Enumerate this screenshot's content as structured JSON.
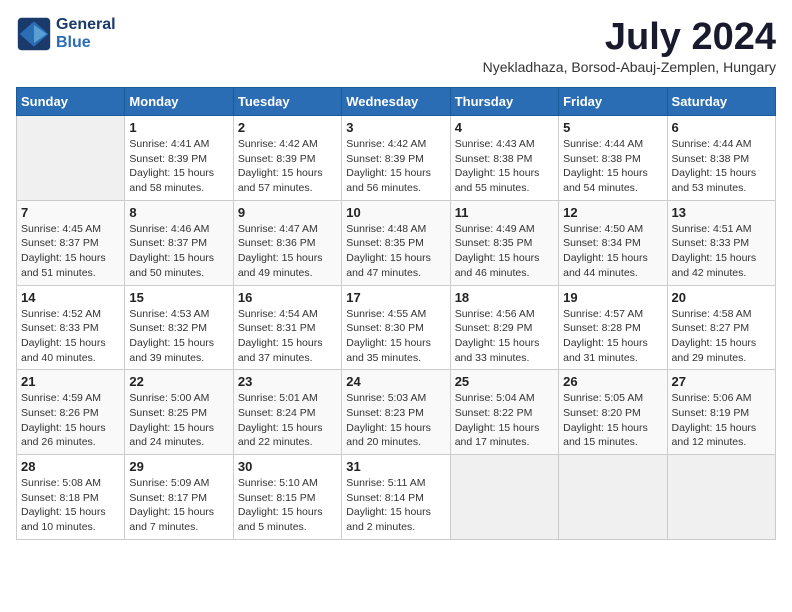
{
  "header": {
    "logo_line1": "General",
    "logo_line2": "Blue",
    "month": "July 2024",
    "location": "Nyekladhaza, Borsod-Abauj-Zemplen, Hungary"
  },
  "weekdays": [
    "Sunday",
    "Monday",
    "Tuesday",
    "Wednesday",
    "Thursday",
    "Friday",
    "Saturday"
  ],
  "weeks": [
    [
      {
        "day": "",
        "info": ""
      },
      {
        "day": "1",
        "info": "Sunrise: 4:41 AM\nSunset: 8:39 PM\nDaylight: 15 hours\nand 58 minutes."
      },
      {
        "day": "2",
        "info": "Sunrise: 4:42 AM\nSunset: 8:39 PM\nDaylight: 15 hours\nand 57 minutes."
      },
      {
        "day": "3",
        "info": "Sunrise: 4:42 AM\nSunset: 8:39 PM\nDaylight: 15 hours\nand 56 minutes."
      },
      {
        "day": "4",
        "info": "Sunrise: 4:43 AM\nSunset: 8:38 PM\nDaylight: 15 hours\nand 55 minutes."
      },
      {
        "day": "5",
        "info": "Sunrise: 4:44 AM\nSunset: 8:38 PM\nDaylight: 15 hours\nand 54 minutes."
      },
      {
        "day": "6",
        "info": "Sunrise: 4:44 AM\nSunset: 8:38 PM\nDaylight: 15 hours\nand 53 minutes."
      }
    ],
    [
      {
        "day": "7",
        "info": "Sunrise: 4:45 AM\nSunset: 8:37 PM\nDaylight: 15 hours\nand 51 minutes."
      },
      {
        "day": "8",
        "info": "Sunrise: 4:46 AM\nSunset: 8:37 PM\nDaylight: 15 hours\nand 50 minutes."
      },
      {
        "day": "9",
        "info": "Sunrise: 4:47 AM\nSunset: 8:36 PM\nDaylight: 15 hours\nand 49 minutes."
      },
      {
        "day": "10",
        "info": "Sunrise: 4:48 AM\nSunset: 8:35 PM\nDaylight: 15 hours\nand 47 minutes."
      },
      {
        "day": "11",
        "info": "Sunrise: 4:49 AM\nSunset: 8:35 PM\nDaylight: 15 hours\nand 46 minutes."
      },
      {
        "day": "12",
        "info": "Sunrise: 4:50 AM\nSunset: 8:34 PM\nDaylight: 15 hours\nand 44 minutes."
      },
      {
        "day": "13",
        "info": "Sunrise: 4:51 AM\nSunset: 8:33 PM\nDaylight: 15 hours\nand 42 minutes."
      }
    ],
    [
      {
        "day": "14",
        "info": "Sunrise: 4:52 AM\nSunset: 8:33 PM\nDaylight: 15 hours\nand 40 minutes."
      },
      {
        "day": "15",
        "info": "Sunrise: 4:53 AM\nSunset: 8:32 PM\nDaylight: 15 hours\nand 39 minutes."
      },
      {
        "day": "16",
        "info": "Sunrise: 4:54 AM\nSunset: 8:31 PM\nDaylight: 15 hours\nand 37 minutes."
      },
      {
        "day": "17",
        "info": "Sunrise: 4:55 AM\nSunset: 8:30 PM\nDaylight: 15 hours\nand 35 minutes."
      },
      {
        "day": "18",
        "info": "Sunrise: 4:56 AM\nSunset: 8:29 PM\nDaylight: 15 hours\nand 33 minutes."
      },
      {
        "day": "19",
        "info": "Sunrise: 4:57 AM\nSunset: 8:28 PM\nDaylight: 15 hours\nand 31 minutes."
      },
      {
        "day": "20",
        "info": "Sunrise: 4:58 AM\nSunset: 8:27 PM\nDaylight: 15 hours\nand 29 minutes."
      }
    ],
    [
      {
        "day": "21",
        "info": "Sunrise: 4:59 AM\nSunset: 8:26 PM\nDaylight: 15 hours\nand 26 minutes."
      },
      {
        "day": "22",
        "info": "Sunrise: 5:00 AM\nSunset: 8:25 PM\nDaylight: 15 hours\nand 24 minutes."
      },
      {
        "day": "23",
        "info": "Sunrise: 5:01 AM\nSunset: 8:24 PM\nDaylight: 15 hours\nand 22 minutes."
      },
      {
        "day": "24",
        "info": "Sunrise: 5:03 AM\nSunset: 8:23 PM\nDaylight: 15 hours\nand 20 minutes."
      },
      {
        "day": "25",
        "info": "Sunrise: 5:04 AM\nSunset: 8:22 PM\nDaylight: 15 hours\nand 17 minutes."
      },
      {
        "day": "26",
        "info": "Sunrise: 5:05 AM\nSunset: 8:20 PM\nDaylight: 15 hours\nand 15 minutes."
      },
      {
        "day": "27",
        "info": "Sunrise: 5:06 AM\nSunset: 8:19 PM\nDaylight: 15 hours\nand 12 minutes."
      }
    ],
    [
      {
        "day": "28",
        "info": "Sunrise: 5:08 AM\nSunset: 8:18 PM\nDaylight: 15 hours\nand 10 minutes."
      },
      {
        "day": "29",
        "info": "Sunrise: 5:09 AM\nSunset: 8:17 PM\nDaylight: 15 hours\nand 7 minutes."
      },
      {
        "day": "30",
        "info": "Sunrise: 5:10 AM\nSunset: 8:15 PM\nDaylight: 15 hours\nand 5 minutes."
      },
      {
        "day": "31",
        "info": "Sunrise: 5:11 AM\nSunset: 8:14 PM\nDaylight: 15 hours\nand 2 minutes."
      },
      {
        "day": "",
        "info": ""
      },
      {
        "day": "",
        "info": ""
      },
      {
        "day": "",
        "info": ""
      }
    ]
  ]
}
